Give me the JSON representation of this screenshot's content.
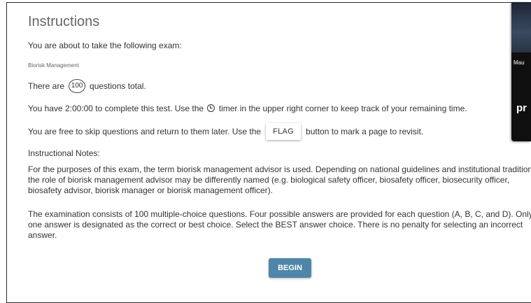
{
  "title": "Instructions",
  "intro_text": "You are about to take the following exam:",
  "exam_name": "Biorisk Management",
  "count_line": {
    "prefix": "There are",
    "count": "100",
    "suffix": "questions total."
  },
  "time_line": {
    "before": "You have 2:00:00 to complete this test. Use the",
    "after": "timer in the upper right corner to keep track of your remaining time."
  },
  "skip_line": {
    "before": "You are free to skip questions and return to them later. Use the",
    "flag_label": "FLAG",
    "after": "button to mark a page to revisit."
  },
  "notes_heading": "Instructional Notes:",
  "paragraph_1": "For the purposes of this exam, the term biorisk management advisor is used. Depending on national guidelines and institutional traditions the role of biorisk management advisor may be differently named (e.g. biological safety officer, biosafety officer, biosecurity officer, biosafety advisor, biorisk manager or biorisk management officer).",
  "paragraph_2": "The examination consists of 100 multiple-choice questions. Four possible answers are provided for each question (A, B, C, and D). Only one answer is designated as the correct or best choice. Select the BEST answer choice. There is no penalty for selecting an incorrect answer.",
  "begin_label": "BEGIN",
  "video_panel": {
    "name": "Mau",
    "overlay": "pr"
  },
  "icons": {
    "timer": "timer-icon"
  }
}
